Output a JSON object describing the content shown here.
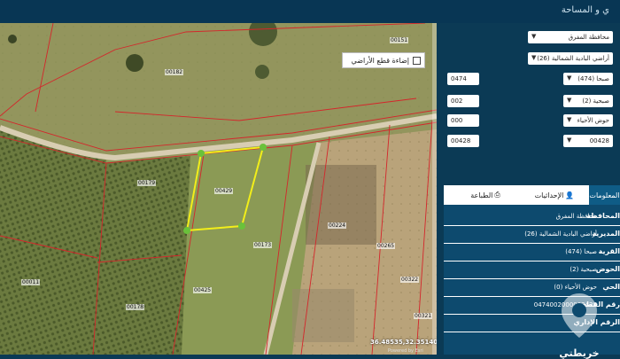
{
  "header": {
    "title": "ي و المساحة"
  },
  "map": {
    "layer_toggle_label": "إضاءة قطع الأراضي",
    "coordinates": "36.48535,32.35140",
    "attribution": "Powered by Esri",
    "plot_labels": [
      "00151",
      "00182",
      "00429",
      "00179",
      "00173",
      "00224",
      "00011",
      "00178",
      "00425",
      "00265",
      "00322",
      "00321"
    ]
  },
  "filters": {
    "governorate": "محافظة المفرق",
    "directorate": "أراضي البادية الشمالية (26)",
    "village": "صبحا (474)",
    "village_code": "0474",
    "basin": "صبحية (2)",
    "basin_code": "002",
    "neighborhood": "حوض الأحياء",
    "neighborhood_code": "000",
    "parcel": "00428",
    "parcel_code": "00428"
  },
  "tabs": {
    "info": "المعلومات",
    "coords": "الإحداثيات",
    "print": "الطباعة"
  },
  "info_rows": [
    {
      "key": "المحافظة",
      "value": "محافظة المفرق"
    },
    {
      "key": "المديرية",
      "value": "أراضي البادية الشمالية (26)"
    },
    {
      "key": "القرية",
      "value": "صبحا (474)"
    },
    {
      "key": "الحوض",
      "value": "صبحية (2)"
    },
    {
      "key": "الحي",
      "value": "حوض الأحياء (0)"
    },
    {
      "key": "رقم القطعة",
      "value": "0474002000002428"
    },
    {
      "key": "الرقم الإداري",
      "value": ""
    }
  ],
  "watermark": {
    "text": "خريطتي"
  }
}
